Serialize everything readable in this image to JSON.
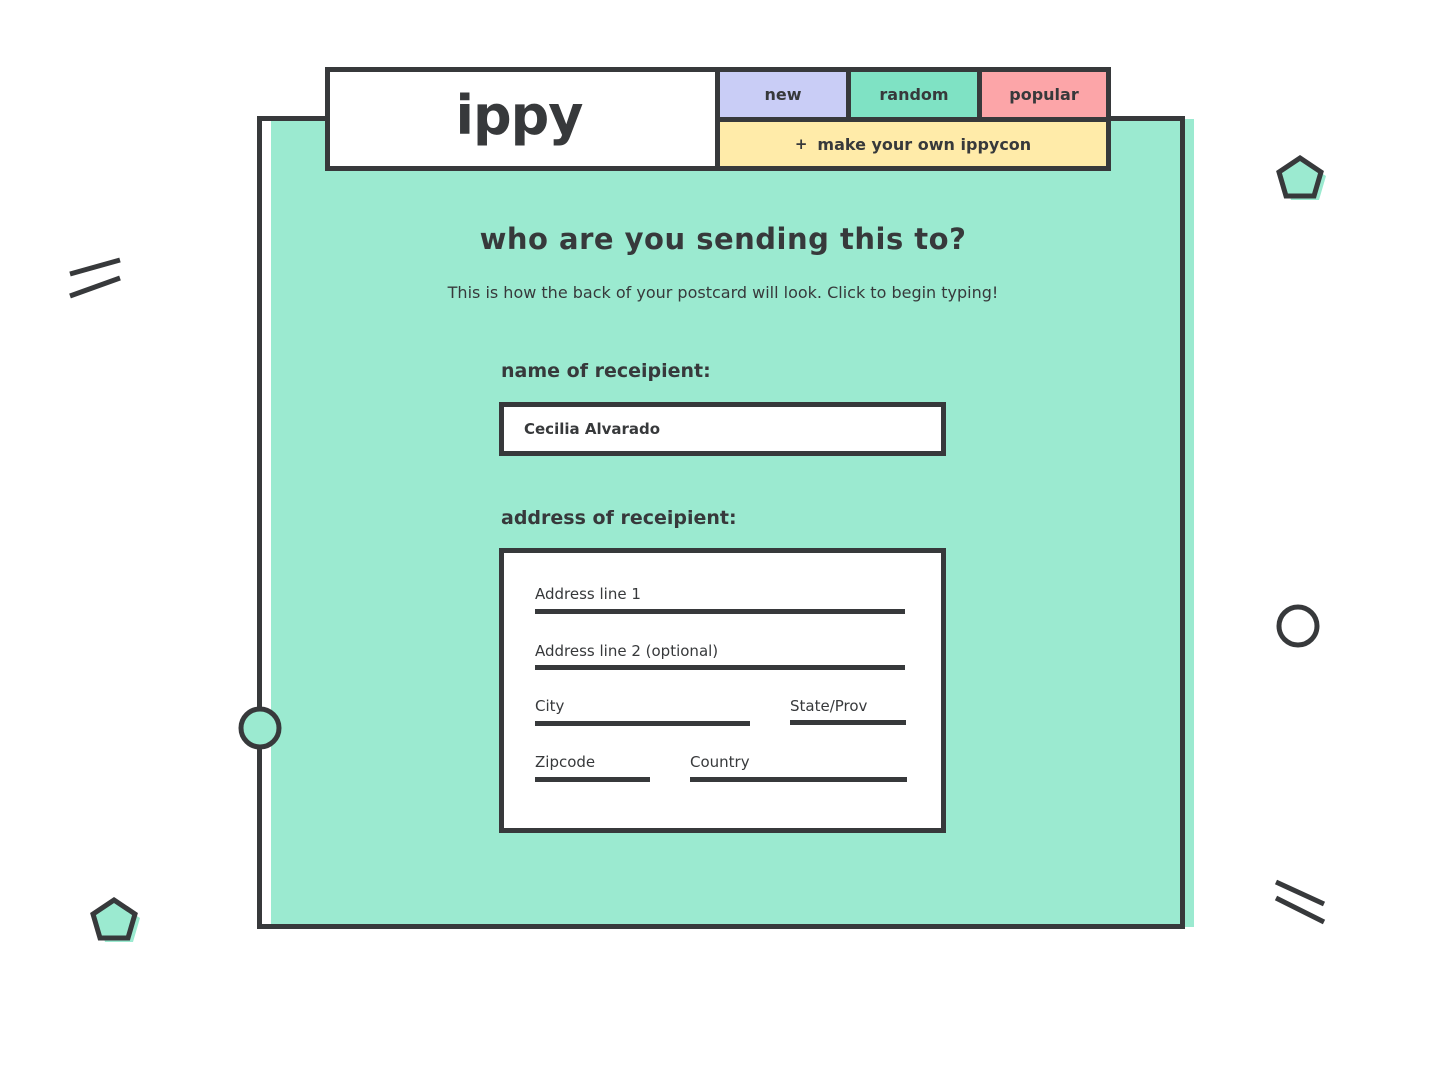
{
  "header": {
    "logo": "ippy",
    "nav": {
      "new": "new",
      "random": "random",
      "popular": "popular",
      "make_own_icon": "+",
      "make_own": "make your own ippycon"
    }
  },
  "main": {
    "title": "who are you sending this to?",
    "subtitle": "This is how the back of your postcard will look. Click to begin typing!",
    "name_label": "name of receipient:",
    "name_value": "Cecilia Alvarado",
    "address_label": "address of receipient:",
    "address": {
      "line1_placeholder": "Address line 1",
      "line2_placeholder": "Address line 2 (optional)",
      "city_placeholder": "City",
      "state_placeholder": "State/Prov",
      "zip_placeholder": "Zipcode",
      "country_placeholder": "Country"
    }
  },
  "colors": {
    "card": "#9bead0",
    "dark": "#37393b",
    "tab_new": "#c9cdf6",
    "tab_random": "#7fe2c4",
    "tab_popular": "#fca5a8",
    "make_own": "#ffeba9"
  },
  "decorations": [
    "double-line-icon",
    "pentagon-icon",
    "circle-icon",
    "circle-icon",
    "pentagon-icon",
    "double-line-icon"
  ]
}
